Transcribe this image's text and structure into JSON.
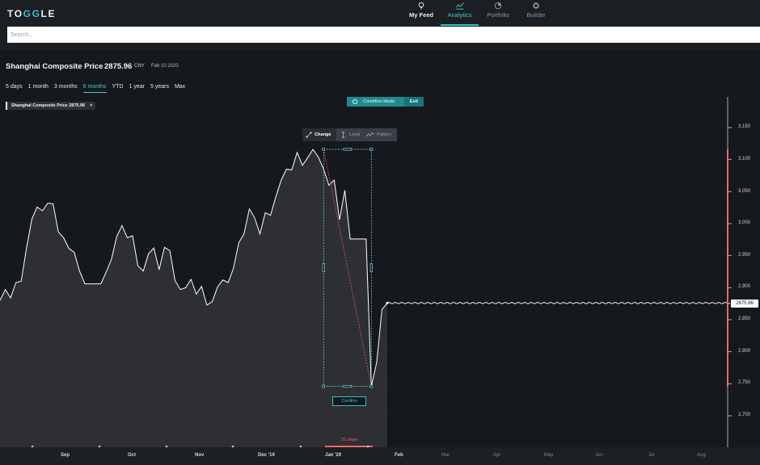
{
  "app": {
    "logo_prefix": "TO",
    "logo_highlight": "GG",
    "logo_suffix": "LE"
  },
  "nav": {
    "items": [
      {
        "label": "My Feed",
        "icon": "bulb-icon"
      },
      {
        "label": "Analytics",
        "icon": "analytics-icon"
      },
      {
        "label": "Portfolio",
        "icon": "pie-chart-icon"
      },
      {
        "label": "Builder",
        "icon": "builder-icon"
      }
    ],
    "active": "Analytics"
  },
  "search": {
    "placeholder": "Search..."
  },
  "asset": {
    "title": "Shanghai Composite Price",
    "price": "2875.96",
    "currency": "CNY",
    "date": "Feb 10 2020"
  },
  "ranges": [
    "5 days",
    "1 month",
    "3 months",
    "6 months",
    "YTD",
    "1 year",
    "5 years",
    "Max"
  ],
  "active_range": "6 months",
  "legend": {
    "label": "Shanghai Composite Price 2875.96",
    "close": "×"
  },
  "condition_mode": {
    "label": "Condition Mode",
    "exit": "Exit"
  },
  "tools": {
    "change": "Change",
    "level": "Level",
    "pattern": "Pattern"
  },
  "confirm_label": "Confirm",
  "duration_label": "21 days",
  "price_tag": "2875.96",
  "colors": {
    "accent": "#2fc3c9",
    "line": "#ffffff",
    "area": "#2d2f33",
    "selection": "#e05a5a",
    "background": "#15181c"
  },
  "chart_data": {
    "type": "area",
    "y_ticks": [
      "3,150",
      "3,100",
      "3,050",
      "3,000",
      "2,950",
      "2,900",
      "2,850",
      "2,800",
      "2,750",
      "2,700"
    ],
    "ylim": [
      2670,
      3170
    ],
    "x_ticks": [
      "Sep",
      "Oct",
      "Nov",
      "Dec '19",
      "Jan '20",
      "Feb",
      "Mar",
      "Apr",
      "May",
      "Jun",
      "Jul",
      "Aug"
    ],
    "future_x_ticks": [
      "Mar",
      "Apr",
      "May",
      "Jun",
      "Jul",
      "Aug"
    ],
    "series": [
      {
        "x": 0,
        "y": 2880
      },
      {
        "x": 1,
        "y": 2897
      },
      {
        "x": 2,
        "y": 2884
      },
      {
        "x": 3,
        "y": 2908
      },
      {
        "x": 4,
        "y": 2910
      },
      {
        "x": 5,
        "y": 2962
      },
      {
        "x": 6,
        "y": 3007
      },
      {
        "x": 7,
        "y": 3026
      },
      {
        "x": 8,
        "y": 3020
      },
      {
        "x": 9,
        "y": 3032
      },
      {
        "x": 10,
        "y": 3031
      },
      {
        "x": 11,
        "y": 2987
      },
      {
        "x": 12,
        "y": 2978
      },
      {
        "x": 13,
        "y": 2961
      },
      {
        "x": 14,
        "y": 2955
      },
      {
        "x": 15,
        "y": 2926
      },
      {
        "x": 16,
        "y": 2906
      },
      {
        "x": 17,
        "y": 2906
      },
      {
        "x": 18,
        "y": 2906
      },
      {
        "x": 19,
        "y": 2906
      },
      {
        "x": 20,
        "y": 2924
      },
      {
        "x": 21,
        "y": 2944
      },
      {
        "x": 22,
        "y": 2980
      },
      {
        "x": 23,
        "y": 2997
      },
      {
        "x": 24,
        "y": 2978
      },
      {
        "x": 25,
        "y": 2981
      },
      {
        "x": 26,
        "y": 2934
      },
      {
        "x": 27,
        "y": 2926
      },
      {
        "x": 28,
        "y": 2953
      },
      {
        "x": 29,
        "y": 2962
      },
      {
        "x": 30,
        "y": 2928
      },
      {
        "x": 31,
        "y": 2963
      },
      {
        "x": 32,
        "y": 2958
      },
      {
        "x": 33,
        "y": 2911
      },
      {
        "x": 34,
        "y": 2897
      },
      {
        "x": 35,
        "y": 2900
      },
      {
        "x": 36,
        "y": 2913
      },
      {
        "x": 37,
        "y": 2890
      },
      {
        "x": 38,
        "y": 2902
      },
      {
        "x": 39,
        "y": 2873
      },
      {
        "x": 40,
        "y": 2878
      },
      {
        "x": 41,
        "y": 2901
      },
      {
        "x": 42,
        "y": 2912
      },
      {
        "x": 43,
        "y": 2908
      },
      {
        "x": 44,
        "y": 2930
      },
      {
        "x": 45,
        "y": 2970
      },
      {
        "x": 46,
        "y": 2984
      },
      {
        "x": 47,
        "y": 3023
      },
      {
        "x": 48,
        "y": 3009
      },
      {
        "x": 49,
        "y": 2984
      },
      {
        "x": 50,
        "y": 3017
      },
      {
        "x": 51,
        "y": 3013
      },
      {
        "x": 52,
        "y": 3042
      },
      {
        "x": 53,
        "y": 3068
      },
      {
        "x": 54,
        "y": 3085
      },
      {
        "x": 55,
        "y": 3084
      },
      {
        "x": 56,
        "y": 3111
      },
      {
        "x": 57,
        "y": 3091
      },
      {
        "x": 58,
        "y": 3103
      },
      {
        "x": 59,
        "y": 3116
      },
      {
        "x": 60,
        "y": 3104
      },
      {
        "x": 61,
        "y": 3085
      },
      {
        "x": 62,
        "y": 3060
      },
      {
        "x": 63,
        "y": 3068
      },
      {
        "x": 64,
        "y": 3006
      },
      {
        "x": 65,
        "y": 3052
      },
      {
        "x": 66,
        "y": 2976
      },
      {
        "x": 67,
        "y": 2976
      },
      {
        "x": 68,
        "y": 2976
      },
      {
        "x": 69,
        "y": 2976
      },
      {
        "x": 70,
        "y": 2746
      },
      {
        "x": 71,
        "y": 2783
      },
      {
        "x": 72,
        "y": 2866
      },
      {
        "x": 73,
        "y": 2876
      }
    ],
    "projection_level": 2875.96,
    "selection": {
      "start_x": 61,
      "end_x": 70,
      "high": 3116,
      "low": 2746,
      "duration": "21 days"
    }
  }
}
